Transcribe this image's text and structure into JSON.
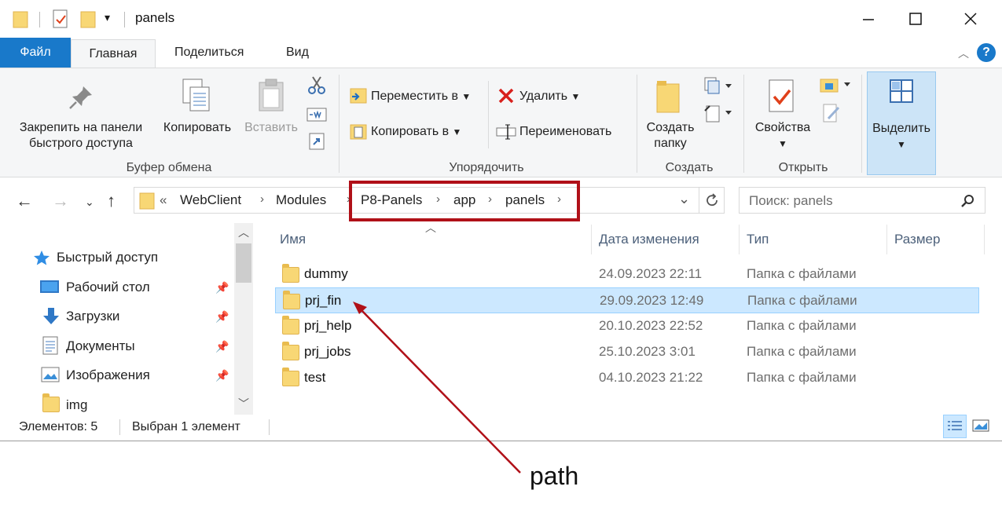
{
  "window": {
    "title": "panels"
  },
  "tabs": {
    "file": "Файл",
    "home": "Главная",
    "share": "Поделиться",
    "view": "Вид"
  },
  "ribbon": {
    "clipboard": {
      "pin_line1": "Закрепить на панели",
      "pin_line2": "быстрого доступа",
      "copy": "Копировать",
      "paste": "Вставить",
      "label": "Буфер обмена"
    },
    "organize": {
      "move_to": "Переместить в",
      "copy_to": "Копировать в",
      "delete": "Удалить",
      "rename": "Переименовать",
      "label": "Упорядочить"
    },
    "create": {
      "new_folder_line1": "Создать",
      "new_folder_line2": "папку",
      "label": "Создать"
    },
    "open": {
      "properties": "Свойства",
      "label": "Открыть"
    },
    "select": {
      "select": "Выделить"
    }
  },
  "address": {
    "overflow": "«",
    "crumbs": [
      "WebClient",
      "Modules",
      "P8-Panels",
      "app",
      "panels"
    ]
  },
  "search": {
    "placeholder": "Поиск: panels"
  },
  "nav": {
    "quick_access": "Быстрый доступ",
    "items": [
      "Рабочий стол",
      "Загрузки",
      "Документы",
      "Изображения",
      "img"
    ]
  },
  "columns": {
    "name": "Имя",
    "date": "Дата изменения",
    "type": "Тип",
    "size": "Размер"
  },
  "files": [
    {
      "name": "dummy",
      "date": "24.09.2023 22:11",
      "type": "Папка с файлами"
    },
    {
      "name": "prj_fin",
      "date": "29.09.2023 12:49",
      "type": "Папка с файлами"
    },
    {
      "name": "prj_help",
      "date": "20.10.2023 22:52",
      "type": "Папка с файлами"
    },
    {
      "name": "prj_jobs",
      "date": "25.10.2023 3:01",
      "type": "Папка с файлами"
    },
    {
      "name": "test",
      "date": "04.10.2023 21:22",
      "type": "Папка с файлами"
    }
  ],
  "selected_index": 1,
  "status": {
    "count": "Элементов: 5",
    "selected": "Выбран 1 элемент"
  },
  "annotation": {
    "label": "path",
    "color": "#b01018"
  },
  "colors": {
    "accent": "#1979ca",
    "selection": "#cce8ff",
    "folder": "#f8d775"
  }
}
